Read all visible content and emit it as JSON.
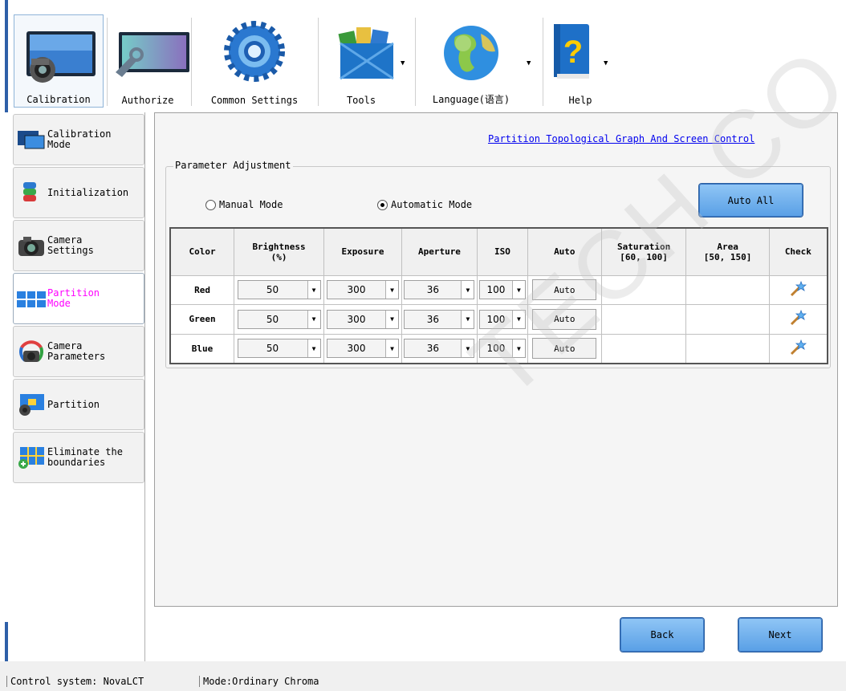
{
  "toolbar": {
    "items": [
      {
        "label": "Calibration",
        "icon": "camera-screen-icon",
        "active": true
      },
      {
        "label": "Authorize",
        "icon": "screen-tool-icon"
      },
      {
        "label": "Common Settings",
        "icon": "gear-icon"
      },
      {
        "label": "Tools",
        "icon": "toolbox-icon"
      },
      {
        "label": "Language(语言)",
        "icon": "globe-icon"
      },
      {
        "label": "Help",
        "icon": "help-book-icon"
      }
    ]
  },
  "nav": {
    "items": [
      {
        "label": "Calibration\nMode"
      },
      {
        "label": "Initialization"
      },
      {
        "label": "Camera\nSettings"
      },
      {
        "label": "Partition\nMode",
        "active": true
      },
      {
        "label": "Camera\nParameters"
      },
      {
        "label": "Partition"
      },
      {
        "label": "Eliminate the\nboundaries"
      }
    ]
  },
  "main": {
    "topo_link": "Partition Topological Graph And Screen Control",
    "group_title": "Parameter Adjustment",
    "manual_mode": "Manual Mode",
    "automatic_mode": "Automatic Mode",
    "auto_all": "Auto All",
    "table": {
      "headers": [
        "Color",
        "Brightness\n(%)",
        "Exposure",
        "Aperture",
        "ISO",
        "Auto",
        "Saturation\n[60, 100]",
        "Area\n[50, 150]",
        "Check"
      ],
      "rows": [
        {
          "color": "Red",
          "brightness": "50",
          "exposure": "300",
          "aperture": "36",
          "iso": "100",
          "auto": "Auto",
          "saturation": "",
          "area": ""
        },
        {
          "color": "Green",
          "brightness": "50",
          "exposure": "300",
          "aperture": "36",
          "iso": "100",
          "auto": "Auto",
          "saturation": "",
          "area": ""
        },
        {
          "color": "Blue",
          "brightness": "50",
          "exposure": "300",
          "aperture": "36",
          "iso": "100",
          "auto": "Auto",
          "saturation": "",
          "area": ""
        }
      ]
    },
    "back": "Back",
    "next": "Next"
  },
  "status": {
    "control_system": "Control system: NovaLCT",
    "mode": "Mode:Ordinary Chroma"
  },
  "watermark": "TECH CO.,LTD"
}
